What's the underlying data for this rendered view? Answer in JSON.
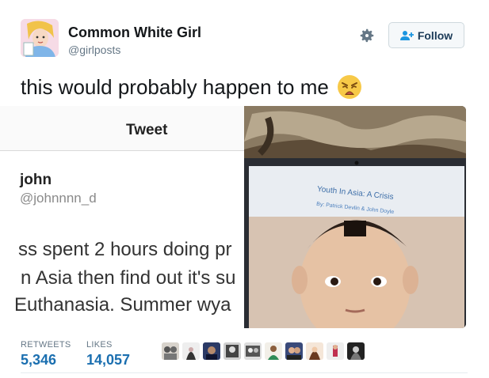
{
  "author": {
    "display_name": "Common White Girl",
    "handle": "@girlposts"
  },
  "actions": {
    "follow_label": "Follow"
  },
  "tweet": {
    "text": "this would probably happen to me",
    "emoji": "weary-face-emoji"
  },
  "embedded_screenshot": {
    "header_title": "Tweet",
    "author_name": "john",
    "author_handle": "@johnnnn_d",
    "lines": [
      "ss spent 2 hours doing pr",
      "n Asia then find out it's su",
      "Euthanasia. Summer wya"
    ]
  },
  "embedded_photo": {
    "slide_title": "Youth In Asia: A Crisis",
    "slide_byline": "By: Patrick Devlin & John Doyle"
  },
  "stats": {
    "retweets_label": "RETWEETS",
    "retweets_value": "5,346",
    "likes_label": "LIKES",
    "likes_value": "14,057"
  },
  "likers_count": 9,
  "colors": {
    "link_blue": "#1b6fb0",
    "follow_text": "#1b3a57",
    "muted": "#657786"
  }
}
